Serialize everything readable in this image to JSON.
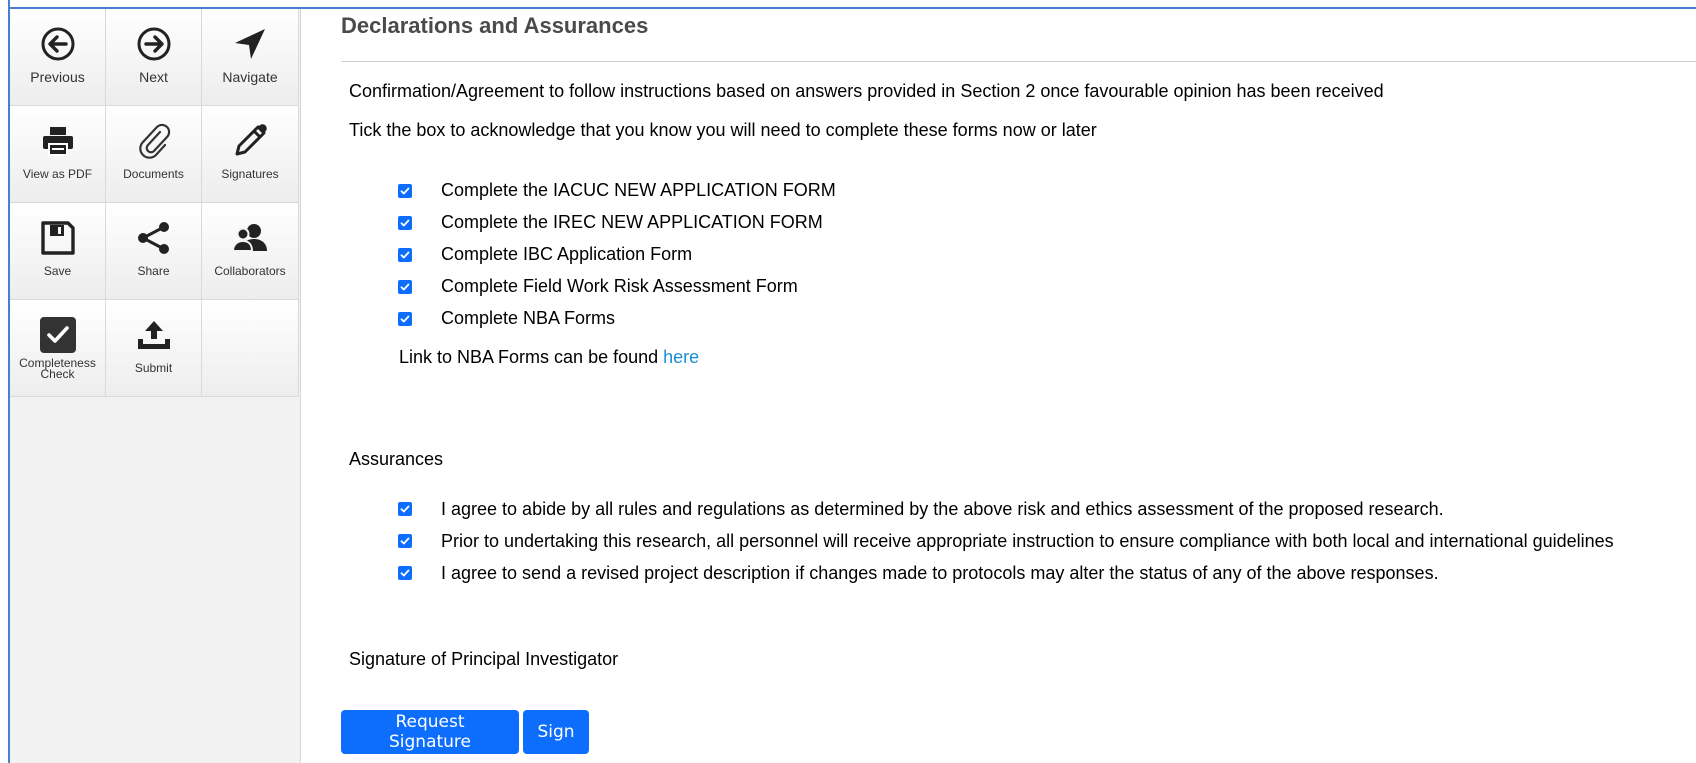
{
  "colors": {
    "accent": "#0d6efd",
    "link": "#1a8fd6",
    "heading": "#4a4a4a"
  },
  "toolbar": [
    {
      "label": "Previous",
      "icon": "previous-circle-arrow-icon"
    },
    {
      "label": "Next",
      "icon": "next-circle-arrow-icon"
    },
    {
      "label": "Navigate",
      "icon": "navigate-arrow-icon"
    },
    {
      "label": "View as PDF",
      "icon": "printer-icon"
    },
    {
      "label": "Documents",
      "icon": "paperclip-icon"
    },
    {
      "label": "Signatures",
      "icon": "pencil-icon"
    },
    {
      "label": "Save",
      "icon": "floppy-disk-icon"
    },
    {
      "label": "Share",
      "icon": "share-icon"
    },
    {
      "label": "Collaborators",
      "icon": "collaborators-icon"
    },
    {
      "label": "Completeness Check",
      "icon": "checkbox-icon"
    },
    {
      "label": "Submit",
      "icon": "upload-tray-icon"
    }
  ],
  "section": {
    "title": "Declarations and Assurances",
    "intro1": "Confirmation/Agreement to follow instructions based on answers provided in Section 2 once favourable opinion has been received",
    "intro2": "Tick the box to acknowledge that you know you will need to complete these forms now or later",
    "forms": [
      {
        "label": "Complete the IACUC NEW APPLICATION FORM",
        "checked": true
      },
      {
        "label": "Complete the IREC NEW APPLICATION FORM",
        "checked": true
      },
      {
        "label": "Complete IBC Application Form",
        "checked": true
      },
      {
        "label": "Complete Field Work Risk Assessment Form",
        "checked": true
      },
      {
        "label": "Complete NBA Forms",
        "checked": true
      }
    ],
    "nba_link_text": "Link to NBA Forms can be found",
    "nba_link_label": "here",
    "assurances_title": "Assurances",
    "assurances": [
      {
        "label": "I agree to abide by all rules and regulations as determined by the above risk and ethics assessment of the proposed research.",
        "checked": true
      },
      {
        "label": "Prior to undertaking this research, all personnel will receive appropriate instruction to ensure compliance with both local and international guidelines",
        "checked": true
      },
      {
        "label": "I agree to send a revised project description if changes made to protocols may alter the status of any of the above responses.",
        "checked": true
      }
    ],
    "signature_title": "Signature of Principal Investigator",
    "request_signature_label": "Request Signature",
    "sign_label": "Sign"
  }
}
